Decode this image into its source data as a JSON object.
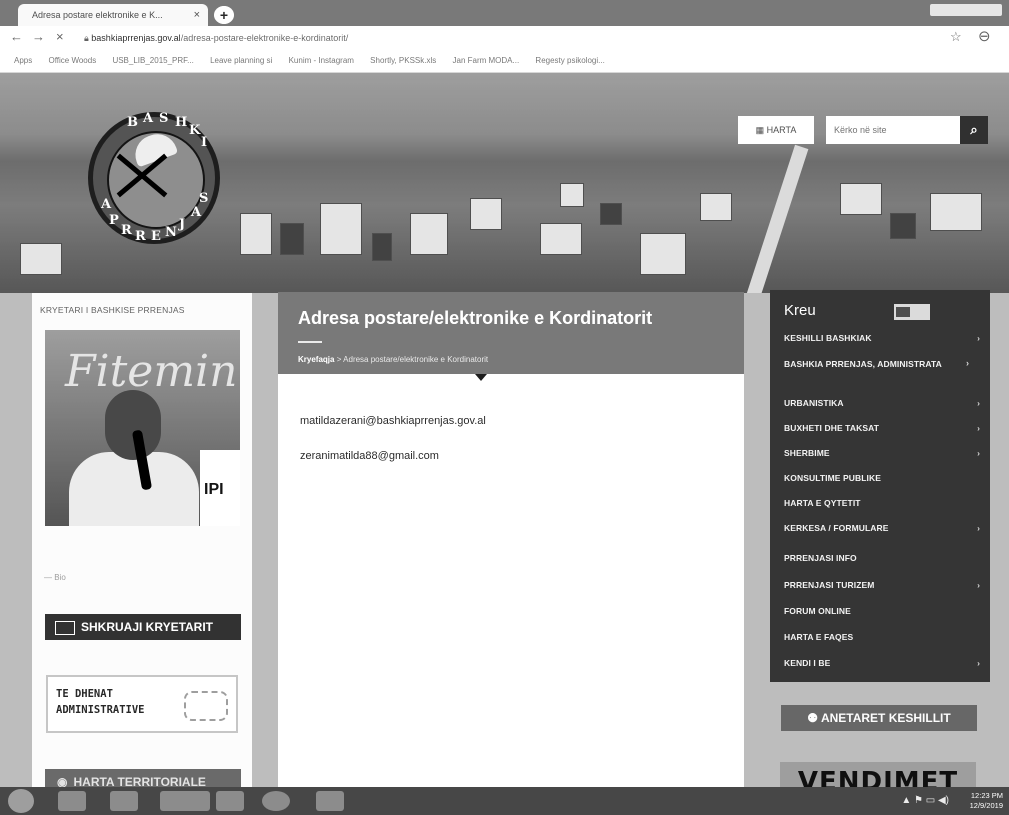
{
  "browser": {
    "tab_title": "Adresa postare elektronike e K...",
    "tab_close": "×",
    "new_tab": "+",
    "nav": {
      "back": "←",
      "forward": "→",
      "reload": "×"
    },
    "url_host": "bashkiaprrenjas.gov.al",
    "url_path": "/adresa-postare-elektronike-e-kordinatorit/",
    "star": "☆",
    "account": "⊖",
    "bookmarks": [
      "Apps",
      "Office Woods",
      "USB_LIB_2015_PRF...",
      "Leave planning si",
      "Kunim - Instagram",
      "Shortly, PKSSk.xls",
      "Jan Farm MODA...",
      "Regesty psikologi..."
    ]
  },
  "header": {
    "logo_letters": [
      "B",
      "A",
      "S",
      "H",
      "K",
      "I",
      "A",
      "P",
      "R",
      "R",
      "E",
      "N",
      "J",
      "A",
      "S"
    ],
    "map_button": "HARTA",
    "search_placeholder": "Kërko në site",
    "search_icon": "magnifier-icon"
  },
  "left": {
    "mayor_label": "KRYETARI I BASHKISE PRRENJAS",
    "photo_script": "Fitemin",
    "photo_side_text": "IPI",
    "bio_link": "— Bio",
    "write_mayor": "SHKRUAJI KRYETARIT",
    "admin_line1": "TE DHENAT",
    "admin_line2": "ADMINISTRATIVE",
    "territorial_map": "HARTA TERRITORIALE"
  },
  "main": {
    "title": "Adresa postare/elektronike e Kordinatorit",
    "breadcrumb_home": "Kryefaqja",
    "breadcrumb_sep": " > ",
    "breadcrumb_current": "Adresa postare/elektronike e Kordinatorit",
    "email_1": "matildazerani@bashkiaprrenjas.gov.al",
    "email_2": "zeranimatilda88@gmail.com"
  },
  "menu": {
    "head": "Kreu",
    "items": [
      {
        "label": "KESHILLI BASHKIAK",
        "arrow": "›"
      },
      {
        "label": "BASHKIA PRRENJAS, ADMINISTRATA",
        "arrow": "›"
      },
      {
        "label": "URBANISTIKA",
        "arrow": "›"
      },
      {
        "label": "BUXHETI DHE TAKSAT",
        "arrow": "›"
      },
      {
        "label": "SHERBIME",
        "arrow": "›"
      },
      {
        "label": "KONSULTIME PUBLIKE",
        "arrow": ""
      },
      {
        "label": "HARTA E QYTETIT",
        "arrow": ""
      },
      {
        "label": "KERKESA / FORMULARE",
        "arrow": "›"
      },
      {
        "label": "PRRENJASI INFO",
        "arrow": ""
      },
      {
        "label": "PRRENJASI TURIZEM",
        "arrow": "›"
      },
      {
        "label": "FORUM ONLINE",
        "arrow": ""
      },
      {
        "label": "HARTA E FAQES",
        "arrow": ""
      },
      {
        "label": "KENDI I BE",
        "arrow": "›"
      }
    ],
    "council_button": "ANETARET KESHILLIT",
    "decisions_banner": "VENDIMET"
  },
  "taskbar": {
    "tray": "▲ ⚑ ▭ ◀)",
    "time": "12:23 PM",
    "date": "12/9/2019"
  }
}
